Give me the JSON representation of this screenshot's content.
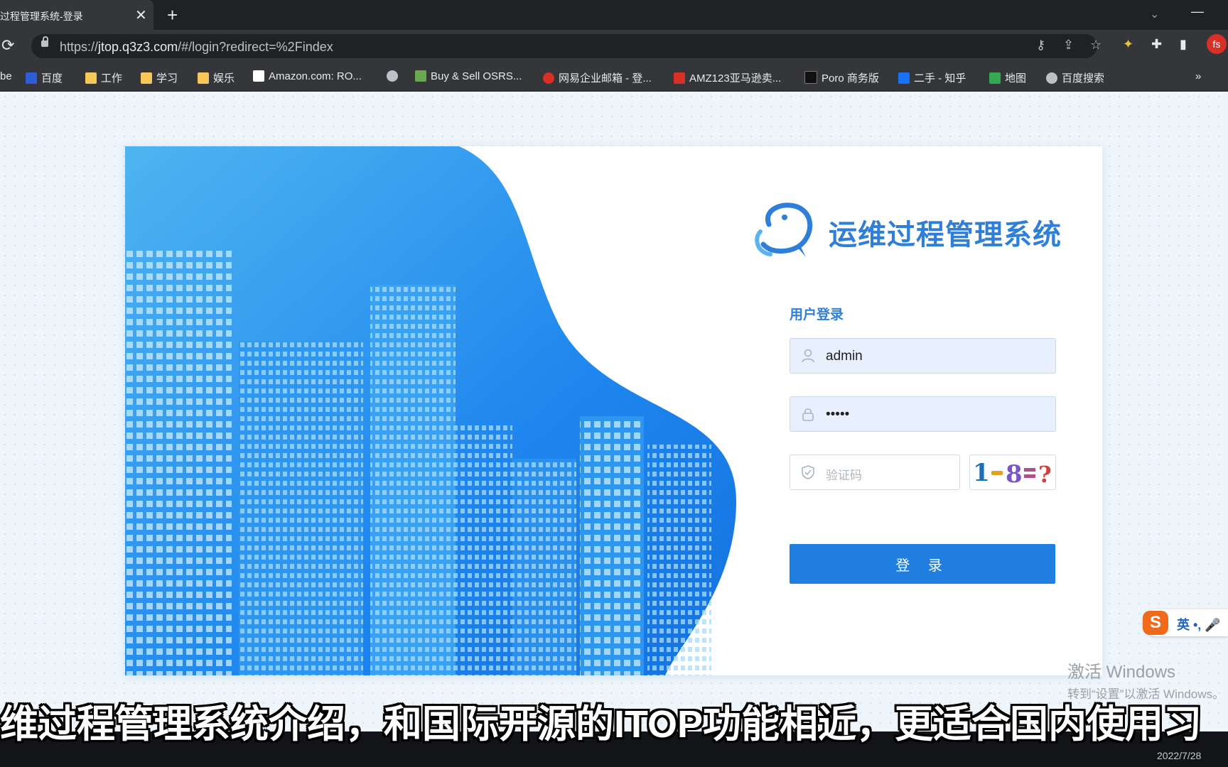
{
  "browser": {
    "tab_title": "过程管理系统-登录",
    "url_host": "jtop.q3z3.com",
    "url_scheme": "https://",
    "url_path": "/#/login?redirect=%2Findex",
    "profile_initials": "fs",
    "bookmarks": [
      {
        "label": "be",
        "color": "#35363a"
      },
      {
        "label": "百度",
        "color": "#2f5dd8"
      },
      {
        "label": "工作",
        "color": "#f6c75a"
      },
      {
        "label": "学习",
        "color": "#f6c75a"
      },
      {
        "label": "娱乐",
        "color": "#f6c75a"
      },
      {
        "label": "Amazon.com: RO...",
        "color": "#ffffff"
      },
      {
        "label": "",
        "color": "#bdc1c6"
      },
      {
        "label": "Buy & Sell OSRS...",
        "color": "#6aa84f"
      },
      {
        "label": "网易企业邮箱 - 登...",
        "color": "#d93025"
      },
      {
        "label": "AMZ123亚马逊卖...",
        "color": "#d93025"
      },
      {
        "label": "Poro 商务版",
        "color": "#111111"
      },
      {
        "label": "二手 - 知乎",
        "color": "#1772f6"
      },
      {
        "label": "地图",
        "color": "#34a853"
      },
      {
        "label": "百度搜索",
        "color": "#bdc1c6"
      }
    ],
    "overflow": "»"
  },
  "login": {
    "system_title": "运维过程管理系统",
    "subtitle": "用户登录",
    "username_value": "admin",
    "password_value": "•••••",
    "captcha_placeholder": "验证码",
    "captcha_image_text": "1-8=?",
    "login_button": "登 录"
  },
  "ime": {
    "logo": "S",
    "text": "英 •, 🎤"
  },
  "watermark": {
    "line1": "激活 Windows",
    "line2": "转到“设置”以激活 Windows。"
  },
  "clock": "2022/7/28",
  "video_subtitle": "维过程管理系统介绍，和国际开源的ITOP功能相近，更适合国内使用习",
  "colors": {
    "accent": "#1f7ee0",
    "title": "#2f7fd8",
    "hero_blue": "#2a8cf0"
  }
}
